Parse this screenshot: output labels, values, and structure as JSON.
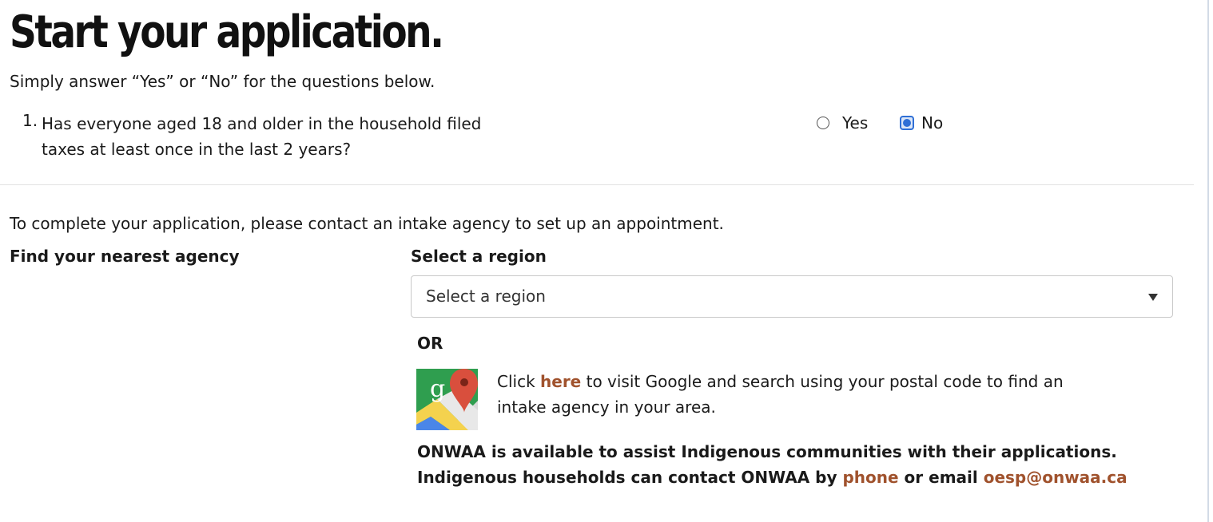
{
  "page": {
    "title": "Start your application.",
    "intro": "Simply answer “Yes” or “No” for the questions below."
  },
  "question": {
    "number": "1.",
    "text": "Has everyone aged 18 and older in the household filed taxes at least once in the last 2 years?",
    "options": [
      {
        "label": "Yes",
        "checked": false
      },
      {
        "label": "No",
        "checked": true
      }
    ]
  },
  "contact": {
    "message": "To complete your application, please contact an intake agency to set up an appointment.",
    "find_heading": "Find your nearest agency",
    "select_heading": "Select a region",
    "select_value": "Select a region",
    "or_label": "OR",
    "maps_icon": "google-maps-icon",
    "click_prefix": "Click ",
    "click_link": "here",
    "click_suffix": " to visit Google and search using your postal code to find an intake agency in your area.",
    "onwaa_line1": "ONWAA is available to assist Indigenous communities with their applications.",
    "onwaa_line2_prefix": "Indigenous households can contact ONWAA by ",
    "phone_link": "phone",
    "onwaa_or": " or email ",
    "email_link": "oesp@onwaa.ca"
  },
  "colors": {
    "link": "#a0522d",
    "radio_accent": "#2f6fd6"
  }
}
